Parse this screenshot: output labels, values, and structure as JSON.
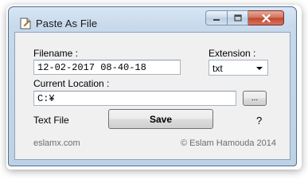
{
  "window": {
    "title": "Paste As File",
    "icon": "file-icon",
    "controls": [
      "minimize-icon",
      "maximize-icon",
      "close-icon"
    ]
  },
  "form": {
    "filename_label": "Filename :",
    "filename_value": "12-02-2017 08-40-18",
    "extension_label": "Extension :",
    "extension_value": "txt",
    "location_label": "Current Location :",
    "location_value": "C:¥",
    "browse_label": "...",
    "file_type": "Text File",
    "save_label": "Save",
    "help_label": "?"
  },
  "footer": {
    "website": "eslamx.com",
    "copyright": "© Eslam Hamouda 2014"
  },
  "colors": {
    "frame_border": "#4d6d8c",
    "close_button": "#c0462d",
    "client_bg": "#f0f0f0"
  }
}
